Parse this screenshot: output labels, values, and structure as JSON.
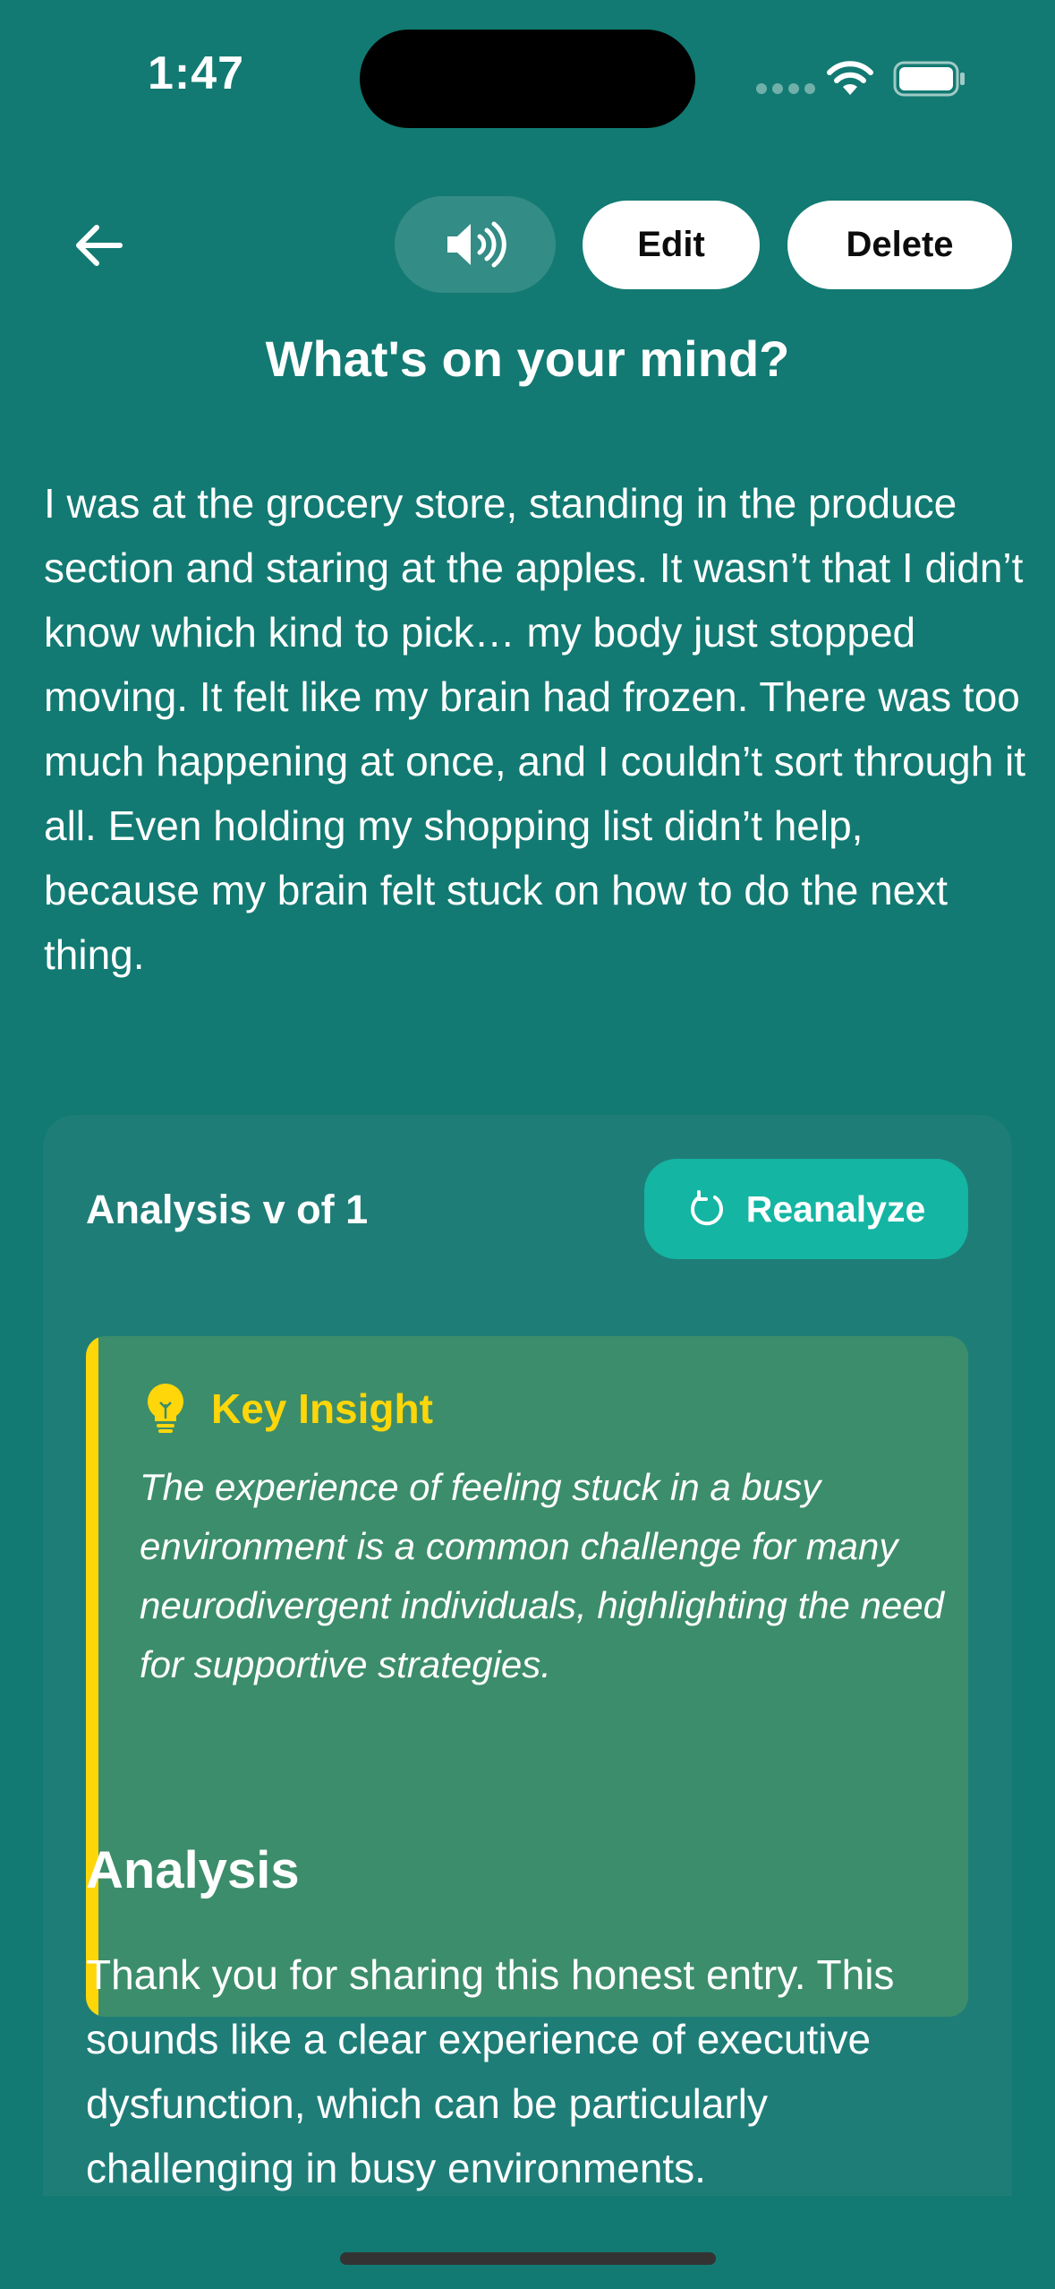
{
  "status_bar": {
    "time": "1:47"
  },
  "toolbar": {
    "back_icon": "arrow-left-icon",
    "speaker_icon": "speaker-wave-icon",
    "edit_label": "Edit",
    "delete_label": "Delete"
  },
  "page": {
    "title": "What's on your mind?",
    "entry_text": "I was at the grocery store, standing in the produce section and staring at the apples. It wasn’t that I didn’t know which kind to pick… my body just stopped moving. It felt like my brain had frozen. There was too much happening at once, and I couldn’t sort through it all. Even holding my shopping list didn’t help, because my brain felt stuck on how to do the next thing."
  },
  "analysis_card": {
    "version_label": "Analysis v of 1",
    "reanalyze_label": "Reanalyze",
    "reanalyze_icon": "refresh-icon",
    "insight": {
      "icon": "lightbulb-icon",
      "title": "Key Insight",
      "text": "The experience of feeling stuck in a busy environment is a common challenge for many neurodivergent individuals, highlighting the need for supportive strategies."
    },
    "analysis_heading": "Analysis",
    "analysis_text": "Thank you for sharing this honest entry. This sounds like a clear experience of executive dysfunction, which can be particularly challenging in busy environments."
  },
  "colors": {
    "background": "#127a72",
    "card": "#1f7d78",
    "reanalyze_button": "#14b5a3",
    "insight_box": "#3c8d6b",
    "insight_accent": "#ffd60a"
  }
}
